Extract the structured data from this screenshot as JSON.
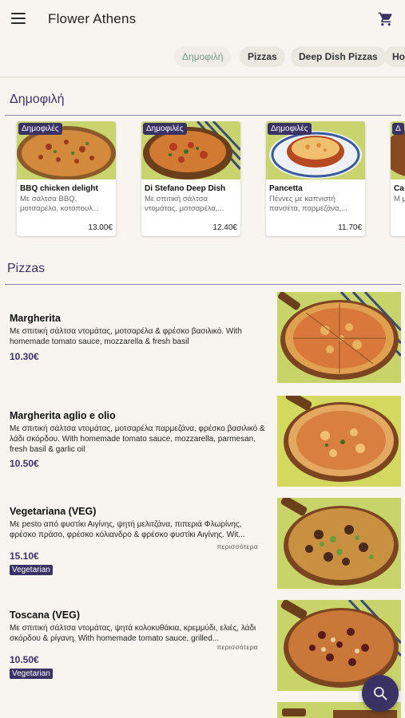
{
  "header": {
    "title": "Flower Athens",
    "menu_icon": "hamburger-menu-icon",
    "cart_icon": "cart-icon"
  },
  "categories": [
    "Δημοφιλή",
    "Pizzas",
    "Deep Dish Pizzas",
    "Ho"
  ],
  "popular": {
    "title": "Δημοφιλή",
    "items": [
      {
        "badge": "Δημοφιλές",
        "name": "BBQ chicken delight",
        "desc": "Με σάλτσα BBQ, μοτσαρέλα, κοτόπουλ...",
        "price": "13.00€"
      },
      {
        "badge": "Δημοφιλές",
        "name": "Di Stefano Deep Dish",
        "desc": "Με σπιτική σάλτσα ντομάτας, μοτσαρέλα,...",
        "price": "12.40€"
      },
      {
        "badge": "Δημοφιλές",
        "name": "Pancetta",
        "desc": "Πέννες με καπνιστή πανσέτα, παρμεζάνα,...",
        "price": "11.70€"
      },
      {
        "badge": "Δ",
        "name": "Ca",
        "desc": "Μ μ",
        "price": ""
      }
    ]
  },
  "pizzas": {
    "title": "Pizzas",
    "items": [
      {
        "name": "Margherita",
        "desc": "Με σπιτική σάλτσα ντομάτας, μοτσαρέλα & φρέσκο βασιλικό. With homemade tomato sauce, mozzarella & fresh basil",
        "price": "10.30€",
        "more": "",
        "tag": ""
      },
      {
        "name": "Margherita aglio e olio",
        "desc": "Με σπιτική σάλτσα ντομάτας, μοτσαρέλα παρμεζάνα, φρέσκο βασιλικό & λάδι σκόρδου. With homemade tomato sauce, mozzarella, parmesan, fresh basil & garlic oil",
        "price": "10.50€",
        "more": "",
        "tag": ""
      },
      {
        "name": "Vegetariana (VEG)",
        "desc": "Με pesto από φυστίκι Αιγίνης, ψητή μελιτζάνα, πιπεριά Φλωρίνης, φρέσκο πράσο, φρέσκο κόλιανδρο & φρέσκο φυστίκι Αιγίνης. Wit...",
        "price": "15.10€",
        "more": "περισσότερα",
        "tag": "Vegetarian"
      },
      {
        "name": "Toscana (VEG)",
        "desc": "Με σπιτική σάλτσα ντομάτας, ψητά κολοκυθάκια, κρεμμύδι, ελιές, λάδι σκόρδου & ρίγανη. With homemade tomato sauce, grilled...",
        "price": "10.50€",
        "more": "περισσότερα",
        "tag": "Vegetarian"
      }
    ]
  },
  "fab": {
    "icon": "search-icon"
  },
  "colors": {
    "accent": "#3a3264",
    "background": "#f8f5f0",
    "image_bg": "#c8d36a"
  }
}
